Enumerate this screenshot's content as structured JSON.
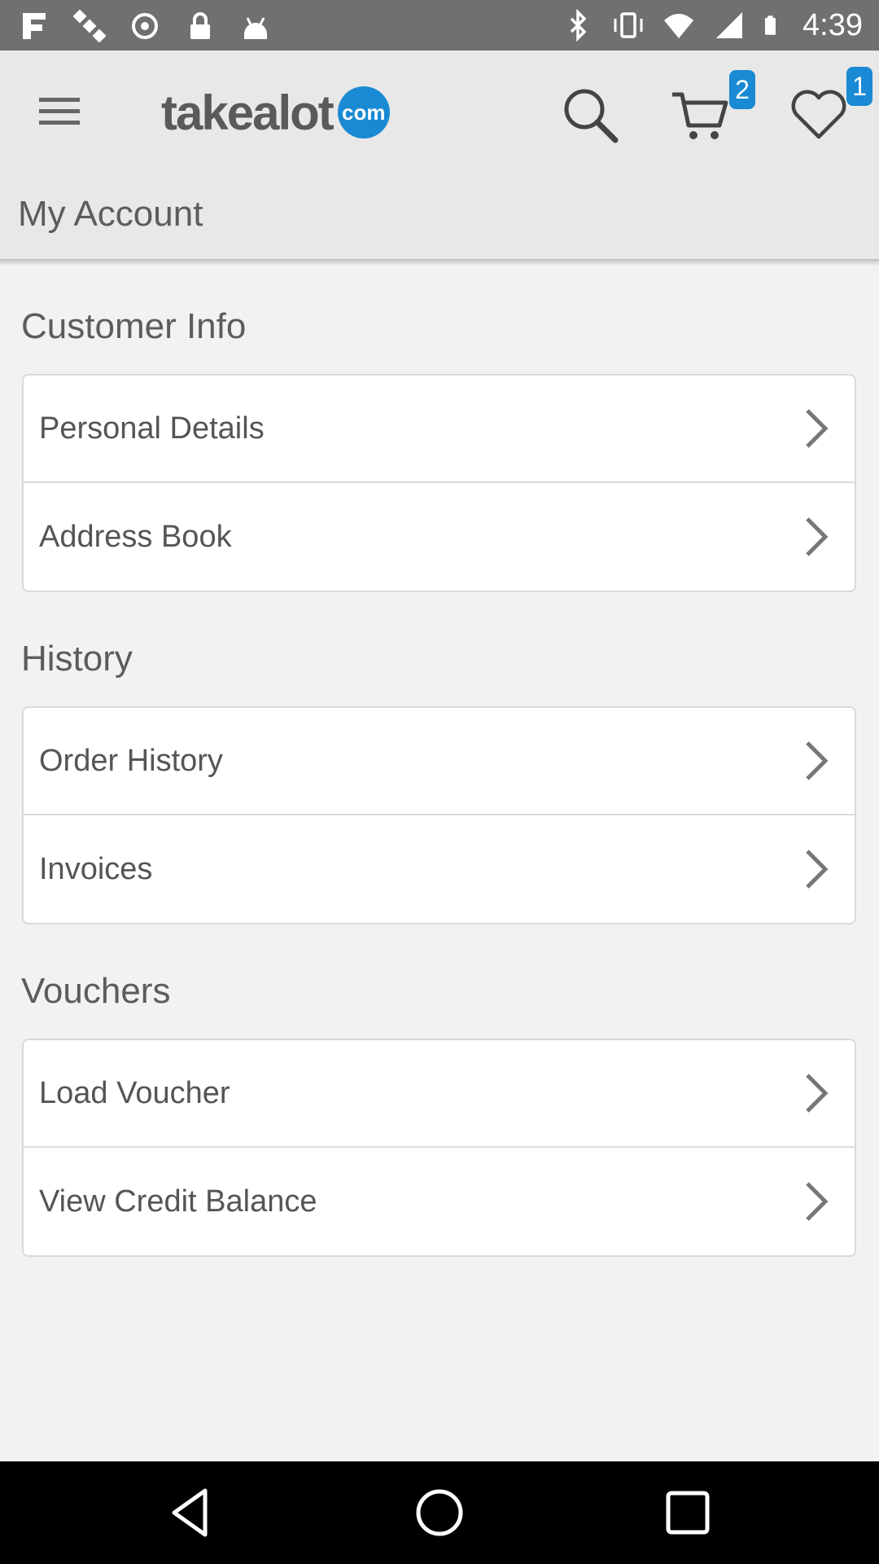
{
  "status_bar": {
    "time": "4:39",
    "icons": [
      "fake-gps-icon",
      "satellite-icon",
      "sync-icon",
      "lock-icon",
      "android-icon",
      "bluetooth-icon",
      "vibrate-icon",
      "wifi-icon",
      "signal-icon",
      "battery-icon"
    ]
  },
  "header": {
    "logo_text": "takealot",
    "logo_suffix": "com",
    "cart_count": "2",
    "wishlist_count": "1",
    "page_title": "My Account"
  },
  "sections": [
    {
      "title": "Customer Info",
      "items": [
        "Personal Details",
        "Address Book"
      ]
    },
    {
      "title": "History",
      "items": [
        "Order History",
        "Invoices"
      ]
    },
    {
      "title": "Vouchers",
      "items": [
        "Load Voucher",
        "View Credit Balance"
      ]
    }
  ],
  "colors": {
    "accent": "#1a8ad4",
    "header_bg": "#e8e8e8",
    "page_bg": "#f2f2f2",
    "text": "#555555"
  }
}
